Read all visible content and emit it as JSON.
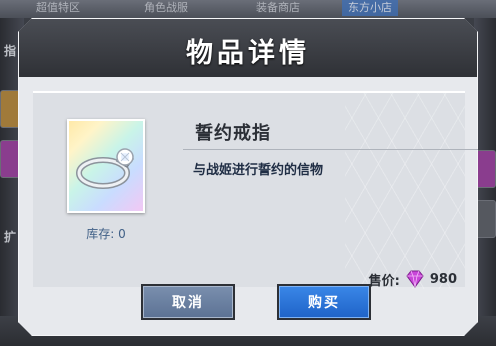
{
  "background": {
    "tabs": [
      "超值特区",
      "角色战服",
      "装备商店",
      "东方小店"
    ],
    "active_tab_index": 3,
    "side_marks": [
      "指",
      "扩"
    ]
  },
  "dialog": {
    "title": "物品详情",
    "item": {
      "name": "誓约戒指",
      "description": "与战姬进行誓约的信物",
      "stock_label": "库存:",
      "stock_value": "0",
      "icon": "ring-icon"
    },
    "price": {
      "label": "售价:",
      "value": "980",
      "currency_icon": "gem-icon"
    },
    "buttons": {
      "cancel_label": "取消",
      "buy_label": "购买"
    }
  },
  "colors": {
    "header": "#3a3d44",
    "panel": "#e7e9ed",
    "cancel_button": "#6b80a1",
    "buy_button": "#2a74dc",
    "gem": "#c845d8"
  }
}
